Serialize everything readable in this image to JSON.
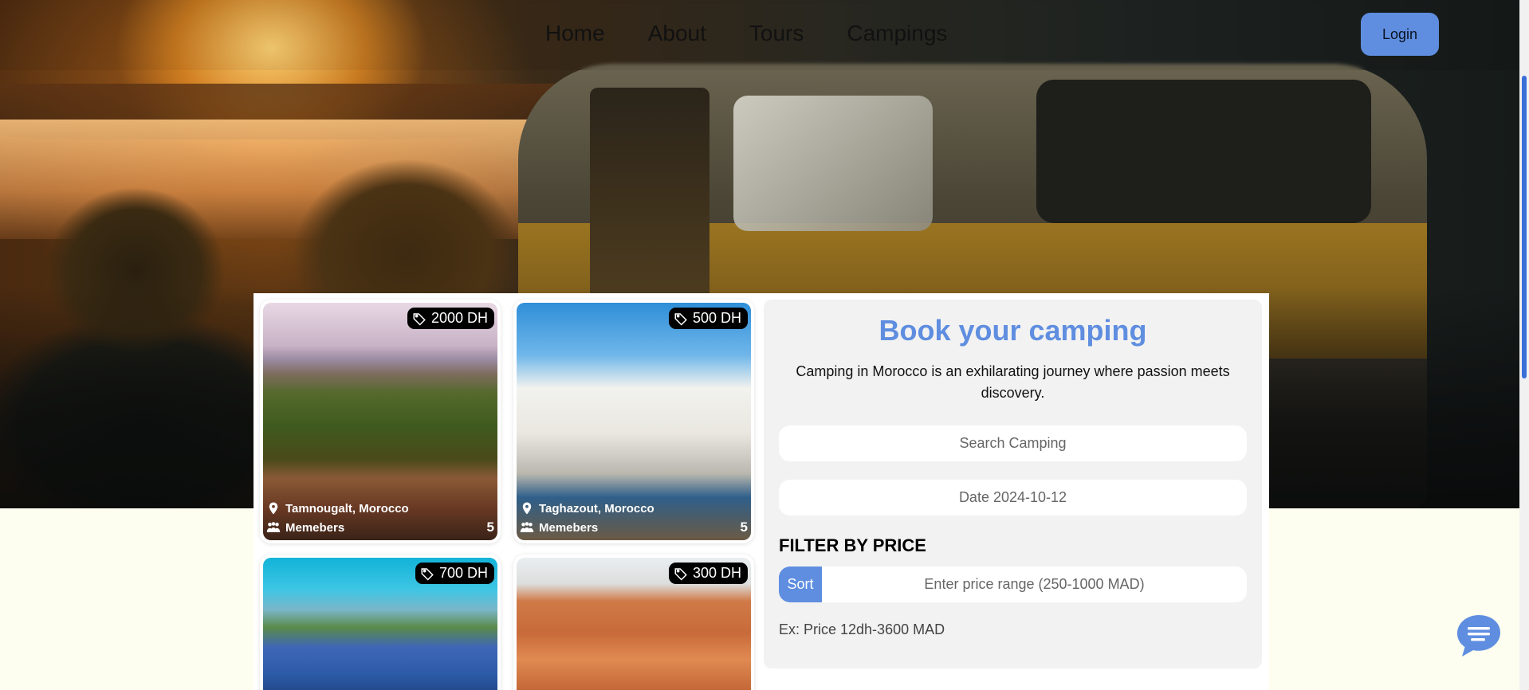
{
  "nav": {
    "links": [
      "Home",
      "About",
      "Tours",
      "Campings"
    ],
    "login_label": "Login"
  },
  "colors": {
    "accent": "#5f8ee0",
    "page_background": "#fefef0",
    "badge_background": "#000000"
  },
  "cards": [
    {
      "price": "2000 DH",
      "location": "Tamnougalt, Morocco",
      "members_label": "Memebers",
      "members_count": "5",
      "icons": [
        "tag-icon",
        "map-pin-icon",
        "people-icon"
      ]
    },
    {
      "price": "500 DH",
      "location": "Taghazout, Morocco",
      "members_label": "Memebers",
      "members_count": "5",
      "icons": [
        "tag-icon",
        "map-pin-icon",
        "people-icon"
      ]
    },
    {
      "price": "700 DH"
    },
    {
      "price": "300 DH"
    }
  ],
  "booking": {
    "title": "Book your camping",
    "description": "Camping in Morocco is an exhilarating journey where passion meets discovery.",
    "search_placeholder": "Search Camping",
    "date_placeholder": "Date 2024-10-12",
    "filter_title": "FILTER BY PRICE",
    "sort_label": "Sort",
    "price_placeholder": "Enter price range (250-1000 MAD)",
    "example_text": "Ex: Price 12dh-3600 MAD"
  },
  "chat": {
    "icon": "chat-bubble-icon"
  }
}
